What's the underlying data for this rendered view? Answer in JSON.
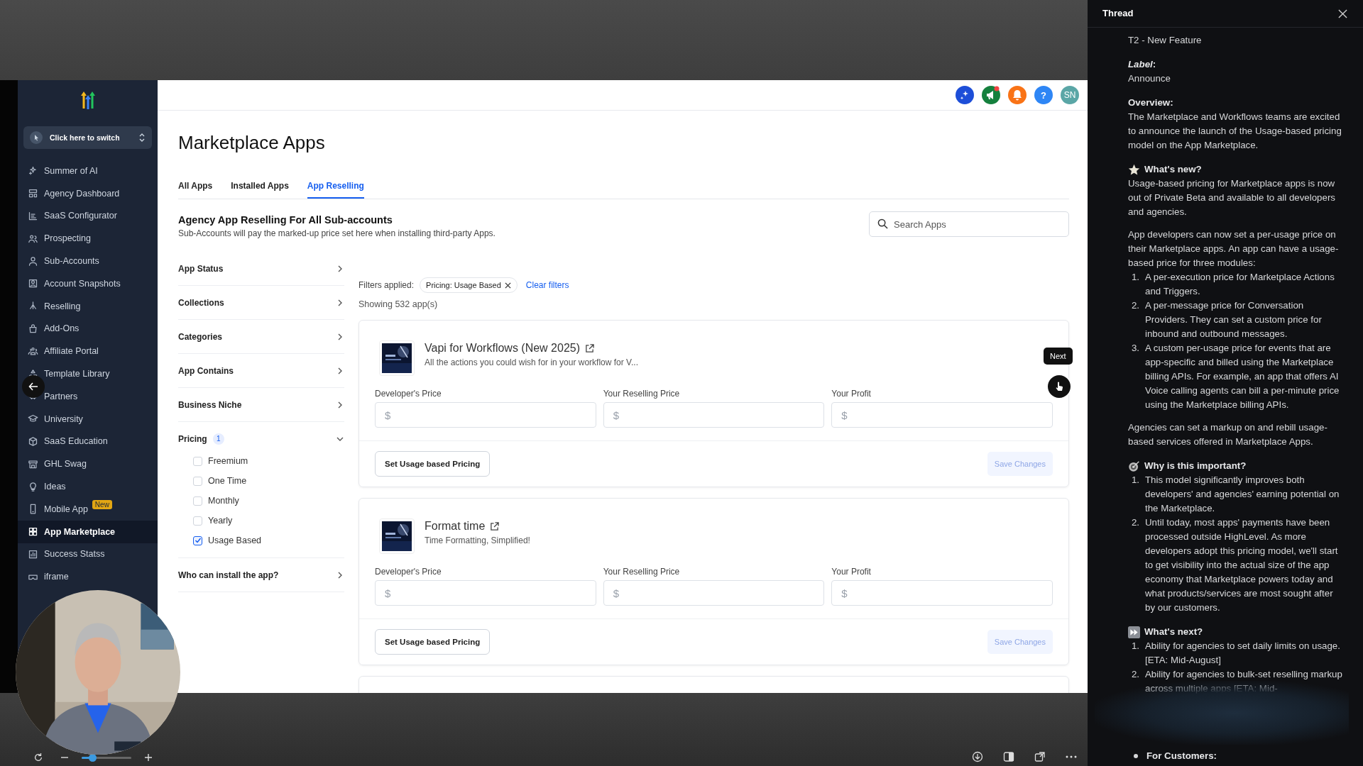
{
  "sidebar": {
    "switcher": "Click here to switch",
    "items": [
      {
        "label": "Summer of AI",
        "selected": false
      },
      {
        "label": "Agency Dashboard",
        "selected": false
      },
      {
        "label": "SaaS Configurator",
        "selected": false
      },
      {
        "label": "Prospecting",
        "selected": false
      },
      {
        "label": "Sub-Accounts",
        "selected": false
      },
      {
        "label": "Account Snapshots",
        "selected": false
      },
      {
        "label": "Reselling",
        "selected": false
      },
      {
        "label": "Add-Ons",
        "selected": false
      },
      {
        "label": "Affiliate Portal",
        "selected": false
      },
      {
        "label": "Template Library",
        "selected": false
      },
      {
        "label": "Partners",
        "selected": false
      },
      {
        "label": "University",
        "selected": false
      },
      {
        "label": "SaaS Education",
        "selected": false
      },
      {
        "label": "GHL Swag",
        "selected": false
      },
      {
        "label": "Ideas",
        "selected": false
      },
      {
        "label": "Mobile App",
        "selected": false,
        "badge": "New"
      },
      {
        "label": "App Marketplace",
        "selected": true
      },
      {
        "label": "Success Statss",
        "selected": false
      },
      {
        "label": "iframe",
        "selected": false
      }
    ]
  },
  "header": {
    "announcements_unread": true,
    "help": "?",
    "avatar": "SN"
  },
  "page": {
    "title": "Marketplace Apps",
    "tabs": [
      {
        "label": "All Apps",
        "selected": false
      },
      {
        "label": "Installed Apps",
        "selected": false
      },
      {
        "label": "App Reselling",
        "selected": true
      }
    ],
    "section": {
      "title": "Agency App Reselling For All Sub-accounts",
      "subtitle": "Sub-Accounts will pay the marked-up price set here when installing third-party Apps."
    },
    "search": {
      "placeholder": "Search Apps"
    }
  },
  "filters": [
    {
      "label": "App Status",
      "expanded": false
    },
    {
      "label": "Collections",
      "expanded": false
    },
    {
      "label": "Categories",
      "expanded": false
    },
    {
      "label": "App Contains",
      "expanded": false
    },
    {
      "label": "Business Niche",
      "expanded": false
    },
    {
      "label": "Pricing",
      "expanded": true,
      "count": "1",
      "options": [
        {
          "label": "Freemium",
          "checked": false
        },
        {
          "label": "One Time",
          "checked": false
        },
        {
          "label": "Monthly",
          "checked": false
        },
        {
          "label": "Yearly",
          "checked": false
        },
        {
          "label": "Usage Based",
          "checked": true
        }
      ]
    },
    {
      "label": "Who can install the app?",
      "expanded": false
    }
  ],
  "applied": {
    "label": "Filters applied:",
    "chips": [
      "Pricing: Usage Based"
    ],
    "clear": "Clear filters",
    "count": "Showing 532 app(s)"
  },
  "apps": [
    {
      "name": "Vapi for Workflows (New 2025)",
      "description": "All the actions you could wish for in your workflow for V...",
      "fields": [
        {
          "label": "Developer's Price",
          "prefix": "$"
        },
        {
          "label": "Your Reselling Price",
          "prefix": "$"
        },
        {
          "label": "Your Profit",
          "prefix": "$"
        }
      ],
      "usage_button": "Set Usage based Pricing",
      "save_button": "Save Changes",
      "save_disabled": true
    },
    {
      "name": "Format time",
      "description": "Time Formatting, Simplified!",
      "fields": [
        {
          "label": "Developer's Price",
          "prefix": "$"
        },
        {
          "label": "Your Reselling Price",
          "prefix": "$"
        },
        {
          "label": "Your Profit",
          "prefix": "$"
        }
      ],
      "usage_button": "Set Usage based Pricing",
      "save_button": "Save Changes",
      "save_disabled": true
    }
  ],
  "tour": {
    "tooltip": "Next"
  },
  "viewer": {
    "zoom": {
      "level": 0.22
    }
  },
  "thread": {
    "title": "Thread",
    "sections": [
      {
        "body": [
          {
            "kind": "paragraph",
            "text": "T2 - New Feature"
          }
        ]
      },
      {
        "heading": {
          "text": "*Label*:"
        },
        "body": [
          {
            "kind": "paragraph",
            "text": "Announce"
          }
        ]
      },
      {
        "heading": {
          "text": "Overview:"
        },
        "body": [
          {
            "kind": "paragraph",
            "text": "The Marketplace and Workflows teams are excited to announce the launch of the Usage-based pricing model on the App Marketplace."
          }
        ]
      },
      {
        "heading": {
          "text": "What's new?"
        },
        "body": [
          {
            "kind": "paragraph",
            "text": "Usage-based pricing for Marketplace apps is now out of Private Beta and available to all developers and agencies."
          },
          {
            "kind": "paragraph",
            "text": "App developers can now set a per-usage price on their Marketplace apps. An app can have a usage-based price for three modules:"
          },
          {
            "kind": "list",
            "items": [
              {
                "number": "1.",
                "text": "A per-execution price for Marketplace Actions and Triggers."
              },
              {
                "number": "2.",
                "text": "A per-message price for Conversation Providers. They can set a custom price for inbound and outbound messages."
              },
              {
                "number": "3.",
                "text": "A custom per-usage price for events that are app-specific and billed using the Marketplace billing APIs. For example, an app that offers AI Voice calling agents can bill a per-minute price using the Marketplace billing APIs."
              }
            ]
          },
          {
            "kind": "paragraph",
            "text": "Agencies can set a markup on and rebill usage-based services offered in Marketplace Apps."
          }
        ]
      },
      {
        "heading": {
          "text": "Why is this important?"
        },
        "body": [
          {
            "kind": "list",
            "items": [
              {
                "number": "1.",
                "text": "This model significantly improves both developers' and agencies' earning potential on the Marketplace."
              },
              {
                "number": "2.",
                "text": "Until today, most apps' payments have been processed outside HighLevel. As more developers adopt this pricing model, we'll start to get visibility into the actual size of the app economy that Marketplace powers today and what products/services are most sought after by our customers."
              }
            ]
          }
        ]
      },
      {
        "heading": {
          "text": "What's next?"
        },
        "body": [
          {
            "kind": "list",
            "items": [
              {
                "number": "1.",
                "text": "Ability for agencies to set daily limits on usage. [ETA: Mid-August]"
              },
              {
                "number": "2.",
                "text": "Ability for agencies to bulk-set reselling markup across multiple apps [ETA: Mid-"
              }
            ]
          }
        ]
      }
    ],
    "footer_bullet": "For Customers:"
  }
}
